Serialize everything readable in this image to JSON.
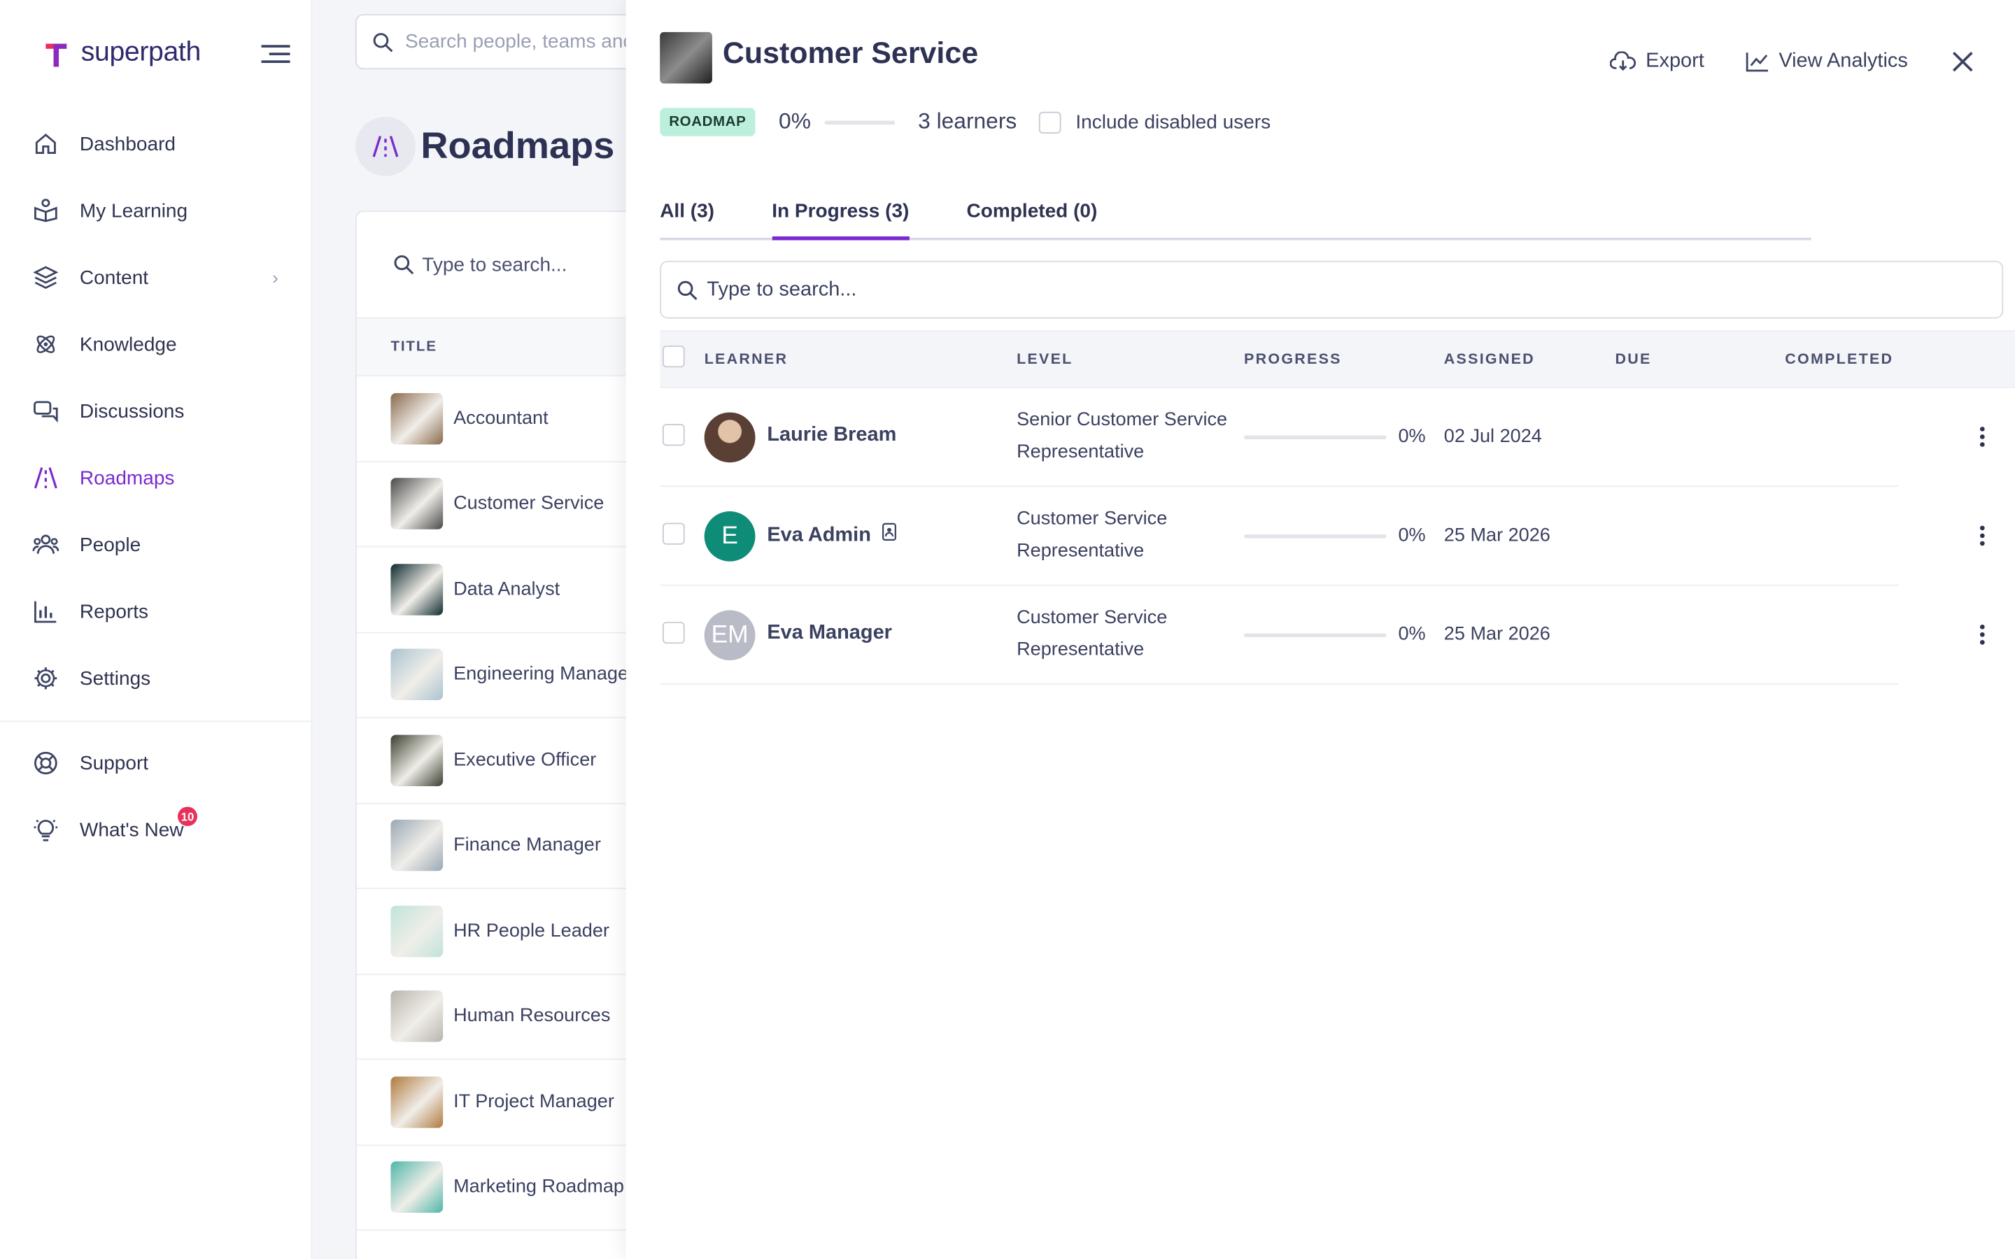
{
  "app": {
    "logo_text": "superpath"
  },
  "sidebar": {
    "items": [
      {
        "label": "Dashboard",
        "icon": "home-icon",
        "active": false
      },
      {
        "label": "My Learning",
        "icon": "learning-icon",
        "active": false
      },
      {
        "label": "Content",
        "icon": "layers-icon",
        "active": false,
        "has_submenu": true
      },
      {
        "label": "Knowledge",
        "icon": "atom-icon",
        "active": false
      },
      {
        "label": "Discussions",
        "icon": "chat-icon",
        "active": false
      },
      {
        "label": "Roadmaps",
        "icon": "roadmap-icon",
        "active": true
      },
      {
        "label": "People",
        "icon": "people-icon",
        "active": false
      },
      {
        "label": "Reports",
        "icon": "chart-icon",
        "active": false
      },
      {
        "label": "Settings",
        "icon": "gear-icon",
        "active": false
      }
    ],
    "bottom_items": [
      {
        "label": "Support",
        "icon": "lifebuoy-icon"
      },
      {
        "label": "What's New",
        "icon": "bulb-icon",
        "badge": "10"
      }
    ]
  },
  "header": {
    "search_placeholder": "Search people, teams and l"
  },
  "page": {
    "title": "Roadmaps",
    "list_search_placeholder": "Type to search...",
    "list_column": "TITLE",
    "roadmaps": [
      {
        "name": "Accountant",
        "thumb": "#8a6a4c"
      },
      {
        "name": "Customer Service",
        "thumb": "#4a4a4a"
      },
      {
        "name": "Data Analyst",
        "thumb": "#0e2a2e"
      },
      {
        "name": "Engineering Manager",
        "thumb": "#a9c3cf"
      },
      {
        "name": "Executive Officer",
        "thumb": "#3a3f2f"
      },
      {
        "name": "Finance Manager",
        "thumb": "#9aa8b4"
      },
      {
        "name": "HR People Leader",
        "thumb": "#bfe3da"
      },
      {
        "name": "Human Resources",
        "thumb": "#b9b4ad"
      },
      {
        "name": "IT Project Manager",
        "thumb": "#b07a3e"
      },
      {
        "name": "Marketing Roadmap",
        "thumb": "#4fb6a7"
      }
    ]
  },
  "drawer": {
    "title": "Customer Service",
    "export_label": "Export",
    "analytics_label": "View Analytics",
    "pill": "ROADMAP",
    "progress_pct": "0%",
    "learners_count": "3 learners",
    "include_disabled_label": "Include disabled users",
    "tabs": [
      {
        "label": "All (3)",
        "active": false
      },
      {
        "label": "In Progress (3)",
        "active": true
      },
      {
        "label": "Completed (0)",
        "active": false
      }
    ],
    "search_placeholder": "Type to search...",
    "columns": {
      "learner": "LEARNER",
      "level": "LEVEL",
      "progress": "PROGRESS",
      "assigned": "ASSIGNED",
      "due": "DUE",
      "completed": "COMPLETED"
    },
    "rows": [
      {
        "name": "Laurie Bream",
        "avatar_text": "",
        "avatar_color": "#5a4034",
        "level": "Senior Customer Service Representative",
        "progress": "0%",
        "progress_value": 0,
        "assigned": "02 Jul 2024",
        "due": "",
        "completed": "",
        "admin_icon": false
      },
      {
        "name": "Eva Admin",
        "avatar_text": "E",
        "avatar_color": "#0f8c78",
        "level": "Customer Service Representative",
        "progress": "0%",
        "progress_value": 0,
        "assigned": "25 Mar 2026",
        "due": "",
        "completed": "",
        "admin_icon": true
      },
      {
        "name": "Eva Manager",
        "avatar_text": "EM",
        "avatar_color": "#b9bcc6",
        "level": "Customer Service Representative",
        "progress": "0%",
        "progress_value": 0,
        "assigned": "25 Mar 2026",
        "due": "",
        "completed": "",
        "admin_icon": false
      }
    ]
  },
  "colors": {
    "accent": "#7a2ad0",
    "text": "#2f3350",
    "pill_bg": "#bdf0dc",
    "badge": "#e8305a"
  }
}
